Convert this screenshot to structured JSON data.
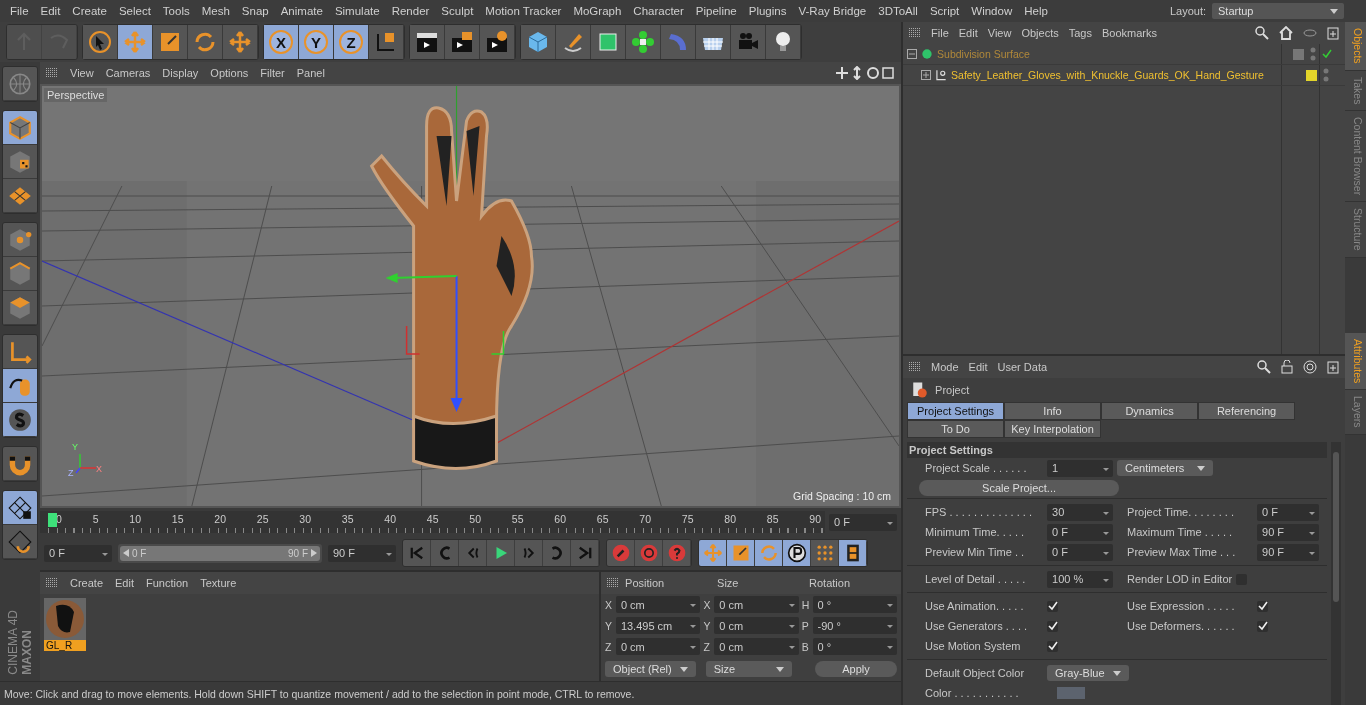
{
  "menu_bar": {
    "items": [
      "File",
      "Edit",
      "Create",
      "Select",
      "Tools",
      "Mesh",
      "Snap",
      "Animate",
      "Simulate",
      "Render",
      "Sculpt",
      "Motion Tracker",
      "MoGraph",
      "Character",
      "Pipeline",
      "Plugins",
      "V-Ray Bridge",
      "3DToAll",
      "Script",
      "Window",
      "Help"
    ],
    "layout_label": "Layout:",
    "layout_value": "Startup"
  },
  "toolbar": [
    [
      {
        "kind": "undo",
        "selected": false,
        "disabled": true
      },
      {
        "kind": "redo",
        "selected": false,
        "disabled": true
      }
    ],
    [
      {
        "kind": "select",
        "selected": false,
        "disabled": false
      },
      {
        "kind": "move",
        "selected": true,
        "disabled": false
      },
      {
        "kind": "scale",
        "selected": false,
        "disabled": false
      },
      {
        "kind": "rotate",
        "selected": false,
        "disabled": false
      },
      {
        "kind": "move-plus",
        "selected": false,
        "disabled": false
      }
    ],
    [
      {
        "kind": "axis-letter",
        "label": "X",
        "selected": true,
        "disabled": false
      },
      {
        "kind": "axis-letter",
        "label": "Y",
        "selected": true,
        "disabled": false
      },
      {
        "kind": "axis-letter",
        "label": "Z",
        "selected": true,
        "disabled": false
      },
      {
        "kind": "coord-system",
        "selected": false,
        "disabled": false
      }
    ],
    [
      {
        "kind": "render-view",
        "selected": false,
        "disabled": false
      },
      {
        "kind": "render-picture",
        "selected": false,
        "disabled": false
      },
      {
        "kind": "render-settings",
        "selected": false,
        "disabled": false
      }
    ],
    [
      {
        "kind": "cube",
        "selected": false,
        "disabled": false
      },
      {
        "kind": "pen",
        "selected": false,
        "disabled": false
      },
      {
        "kind": "subdivide",
        "selected": false,
        "disabled": false
      },
      {
        "kind": "cloner",
        "selected": false,
        "disabled": false
      },
      {
        "kind": "deformer",
        "selected": false,
        "disabled": false
      },
      {
        "kind": "floor",
        "selected": false,
        "disabled": false
      },
      {
        "kind": "camera",
        "selected": false,
        "disabled": false
      },
      {
        "kind": "light",
        "selected": false,
        "disabled": false
      }
    ]
  ],
  "left_toolbar": [
    [
      {
        "kind": "globe",
        "selected": false
      }
    ],
    [
      {
        "kind": "model",
        "selected": true
      },
      {
        "kind": "texture",
        "selected": false
      },
      {
        "kind": "workplane",
        "selected": false
      }
    ],
    [
      {
        "kind": "points",
        "selected": false
      },
      {
        "kind": "edges",
        "selected": false
      },
      {
        "kind": "polygons",
        "selected": false
      }
    ],
    [
      {
        "kind": "axis",
        "selected": false
      },
      {
        "kind": "tweak",
        "selected": true
      },
      {
        "kind": "snap",
        "selected": true
      }
    ],
    [
      {
        "kind": "magnet",
        "selected": false
      }
    ],
    [
      {
        "kind": "lock-grid",
        "selected": true
      },
      {
        "kind": "grid-rotate",
        "selected": false
      }
    ]
  ],
  "logo": {
    "brand": "MAXON",
    "product": "CINEMA 4D"
  },
  "viewport": {
    "menu": [
      "View",
      "Cameras",
      "Display",
      "Options",
      "Filter",
      "Panel"
    ],
    "camera": "Perspective",
    "grid_spacing": "Grid Spacing : 10 cm",
    "axes": [
      "Y",
      "Z",
      "X"
    ]
  },
  "timeline": {
    "ticks": [
      "0",
      "5",
      "10",
      "15",
      "20",
      "25",
      "30",
      "35",
      "40",
      "45",
      "50",
      "55",
      "60",
      "65",
      "70",
      "75",
      "80",
      "85",
      "90"
    ],
    "current_frame": "0 F",
    "start": "0 F",
    "range": {
      "start": "0 F",
      "end": "90 F",
      "level": 1
    },
    "end": "90 F"
  },
  "playback": [
    {
      "kind": "first"
    },
    {
      "kind": "prev-key"
    },
    {
      "kind": "prev-frame"
    },
    {
      "kind": "play"
    },
    {
      "kind": "next-frame"
    },
    {
      "kind": "next-key"
    },
    {
      "kind": "last"
    }
  ],
  "key_buttons": [
    {
      "kind": "record"
    },
    {
      "kind": "autokey"
    },
    {
      "kind": "key-help"
    }
  ],
  "key_tracks": [
    {
      "kind": "move",
      "selected": true
    },
    {
      "kind": "scale",
      "selected": true
    },
    {
      "kind": "rotate",
      "selected": true
    },
    {
      "kind": "param",
      "selected": true
    },
    {
      "kind": "points",
      "selected": false
    },
    {
      "kind": "film",
      "selected": true
    }
  ],
  "material_manager": {
    "menu": [
      "Create",
      "Edit",
      "Function",
      "Texture"
    ],
    "materials": [
      {
        "name": "GL_R",
        "selected": true
      }
    ]
  },
  "coordinates": {
    "headers": [
      "Position",
      "Size",
      "Rotation"
    ],
    "rows": [
      {
        "p_axis": "X",
        "position": "0 cm",
        "s_axis": "X",
        "size": "0 cm",
        "r_axis": "H",
        "rotation": "0 °"
      },
      {
        "p_axis": "Y",
        "position": "13.495 cm",
        "s_axis": "Y",
        "size": "0 cm",
        "r_axis": "P",
        "rotation": "-90 °"
      },
      {
        "p_axis": "Z",
        "position": "0 cm",
        "s_axis": "Z",
        "size": "0 cm",
        "r_axis": "B",
        "rotation": "0 °"
      }
    ],
    "mode": "Object (Rel)",
    "size_mode": "Size",
    "apply": "Apply"
  },
  "status_bar": "Move: Click and drag to move elements. Hold down SHIFT to quantize movement / add to the selection in point mode, CTRL to remove.",
  "object_manager": {
    "menu": [
      "File",
      "Edit",
      "View",
      "Objects",
      "Tags",
      "Bookmarks"
    ],
    "objects": [
      {
        "name": "Subdivision Surface",
        "kind": "subdivision",
        "expanded": true,
        "enabled": true,
        "tags": [
          {
            "kind": "generator"
          }
        ],
        "children": [
          {
            "name": "Safety_Leather_Gloves_with_Knuckle_Guards_OK_Hand_Gesture",
            "kind": "null",
            "expanded": false,
            "enabled": false,
            "tags": [
              {
                "kind": "material"
              }
            ]
          }
        ]
      }
    ]
  },
  "right_tabs_top": [
    {
      "label": "Objects",
      "selected": true
    },
    {
      "label": "Takes",
      "selected": false
    },
    {
      "label": "Content Browser",
      "selected": false
    },
    {
      "label": "Structure",
      "selected": false
    }
  ],
  "right_tabs_bottom": [
    {
      "label": "Attributes",
      "selected": true
    },
    {
      "label": "Layers",
      "selected": false
    }
  ],
  "attributes": {
    "menu": [
      "Mode",
      "Edit",
      "User Data"
    ],
    "title": "Project",
    "tabs": [
      [
        {
          "label": "Project Settings",
          "selected": true
        },
        {
          "label": "Info",
          "selected": false
        },
        {
          "label": "Dynamics",
          "selected": false
        },
        {
          "label": "Referencing",
          "selected": false
        }
      ],
      [
        {
          "label": "To Do",
          "selected": false
        },
        {
          "label": "Key Interpolation",
          "selected": false
        }
      ]
    ],
    "section": "Project Settings",
    "scale_label": "Project Scale . . . . . .",
    "scale_value": "1",
    "scale_unit": "Centimeters",
    "scale_button": "Scale Project...",
    "time_left": [
      {
        "label": "FPS . . . . . . . . . . . . . .",
        "value": "30"
      },
      {
        "label": "Minimum Time. . . . .",
        "value": "0 F"
      },
      {
        "label": "Preview Min Time . .",
        "value": "0 F"
      }
    ],
    "time_right": [
      {
        "label": "Project Time. . . . . . . .",
        "value": "0 F"
      },
      {
        "label": "Maximum Time . . . . .",
        "value": "90 F"
      },
      {
        "label": "Preview Max Time . . .",
        "value": "90 F"
      }
    ],
    "lod_label": "Level of Detail . . . . .",
    "lod_value": "100 %",
    "render_lod_label": "Render LOD in Editor",
    "render_lod_checked": false,
    "flags_left": [
      {
        "label": "Use Animation. . . . .",
        "checked": true
      },
      {
        "label": "Use Generators . . . .",
        "checked": true
      },
      {
        "label": "Use Motion System",
        "checked": true
      }
    ],
    "flags_right": [
      {
        "label": "Use Expression . . . . .",
        "checked": true
      },
      {
        "label": "Use Deformers. . . . . .",
        "checked": true
      }
    ],
    "default_color_label": "Default Object Color",
    "default_color_value": "Gray-Blue",
    "color_label": "Color . . . . . . . . . . .",
    "color": "#5c636e"
  }
}
